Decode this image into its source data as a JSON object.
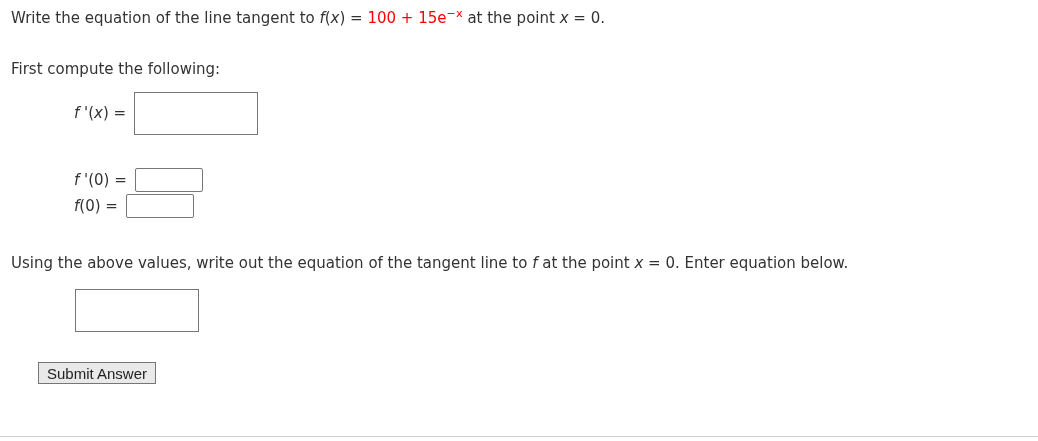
{
  "question": {
    "before": "Write the equation of the line tangent to *f*(*x*) = ",
    "function": "100 + 15e$^{−x}$",
    "after": " at the point *x* = 0."
  },
  "intro": "First compute the following:",
  "answers": [
    {
      "label": "*f* '(*x*) =",
      "kind": "large"
    },
    {
      "label": "*f* '(0) =",
      "kind": "small"
    },
    {
      "label": "*f*(0) =",
      "kind": "small"
    }
  ],
  "instruction": "Using the above values, write out the equation of the tangent line to *f* at the point *x* = 0. Enter equation below.",
  "submit": "Submit Answer"
}
